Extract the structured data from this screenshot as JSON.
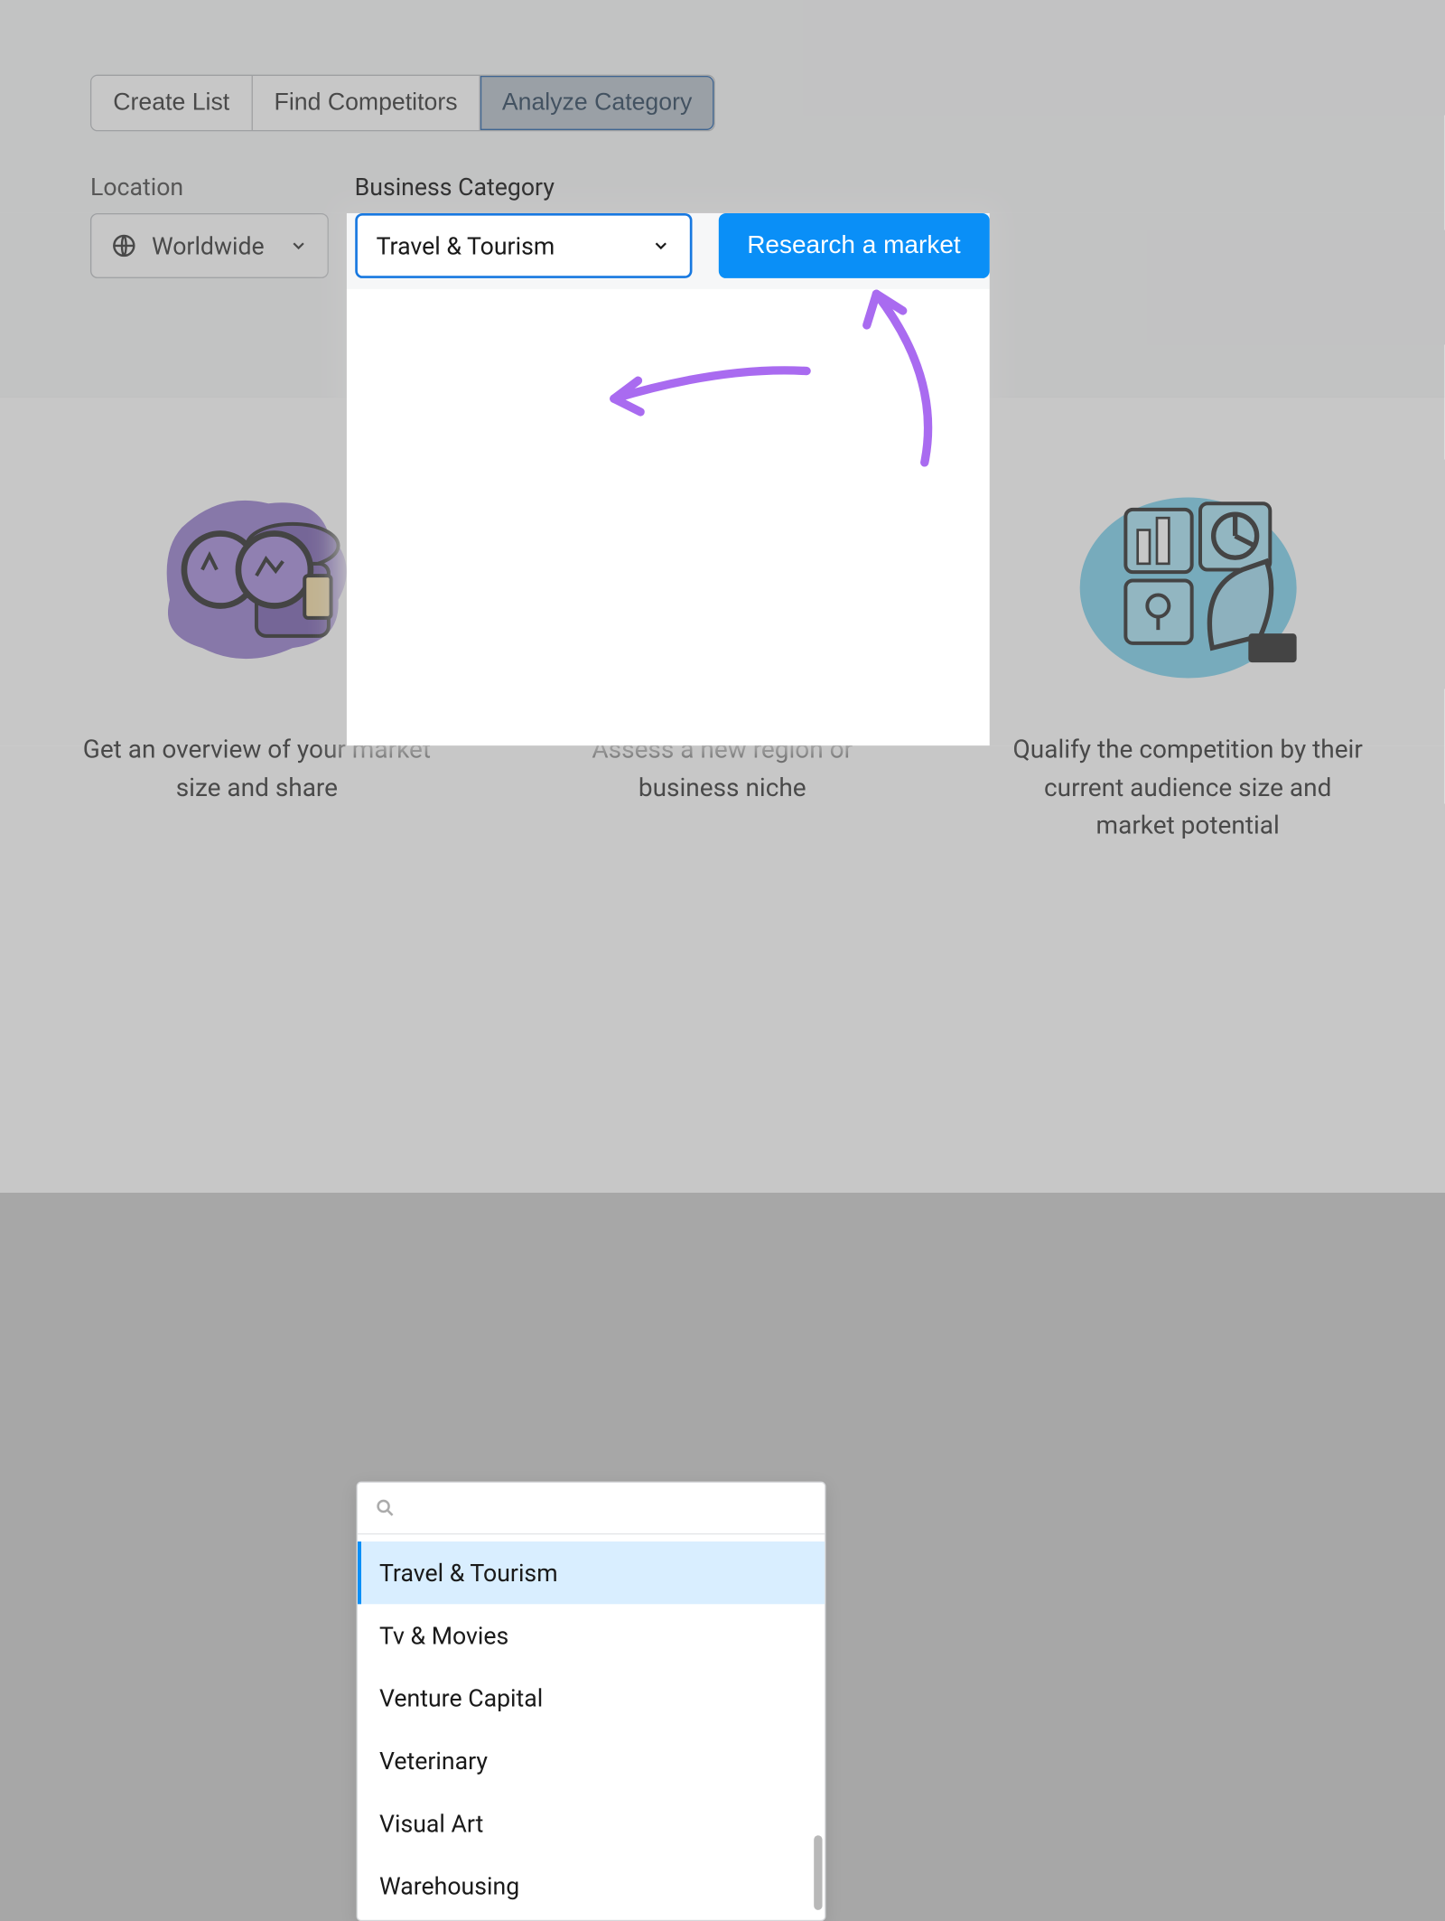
{
  "tabs": {
    "create": "Create List",
    "find": "Find Competitors",
    "analyze": "Analyze Category"
  },
  "location": {
    "label": "Location",
    "value": "Worldwide"
  },
  "category": {
    "label": "Business Category",
    "value": "Travel & Tourism"
  },
  "cta": "Research a market",
  "dropdown": {
    "options": [
      "Travel & Tourism",
      "Tv & Movies",
      "Venture Capital",
      "Veterinary",
      "Visual Art",
      "Warehousing"
    ]
  },
  "cards": {
    "overview": "Get an overview of your market size and share",
    "assess": "Assess a new region or business niche",
    "qualify": "Qualify the competition by their current audience size and market potential"
  }
}
